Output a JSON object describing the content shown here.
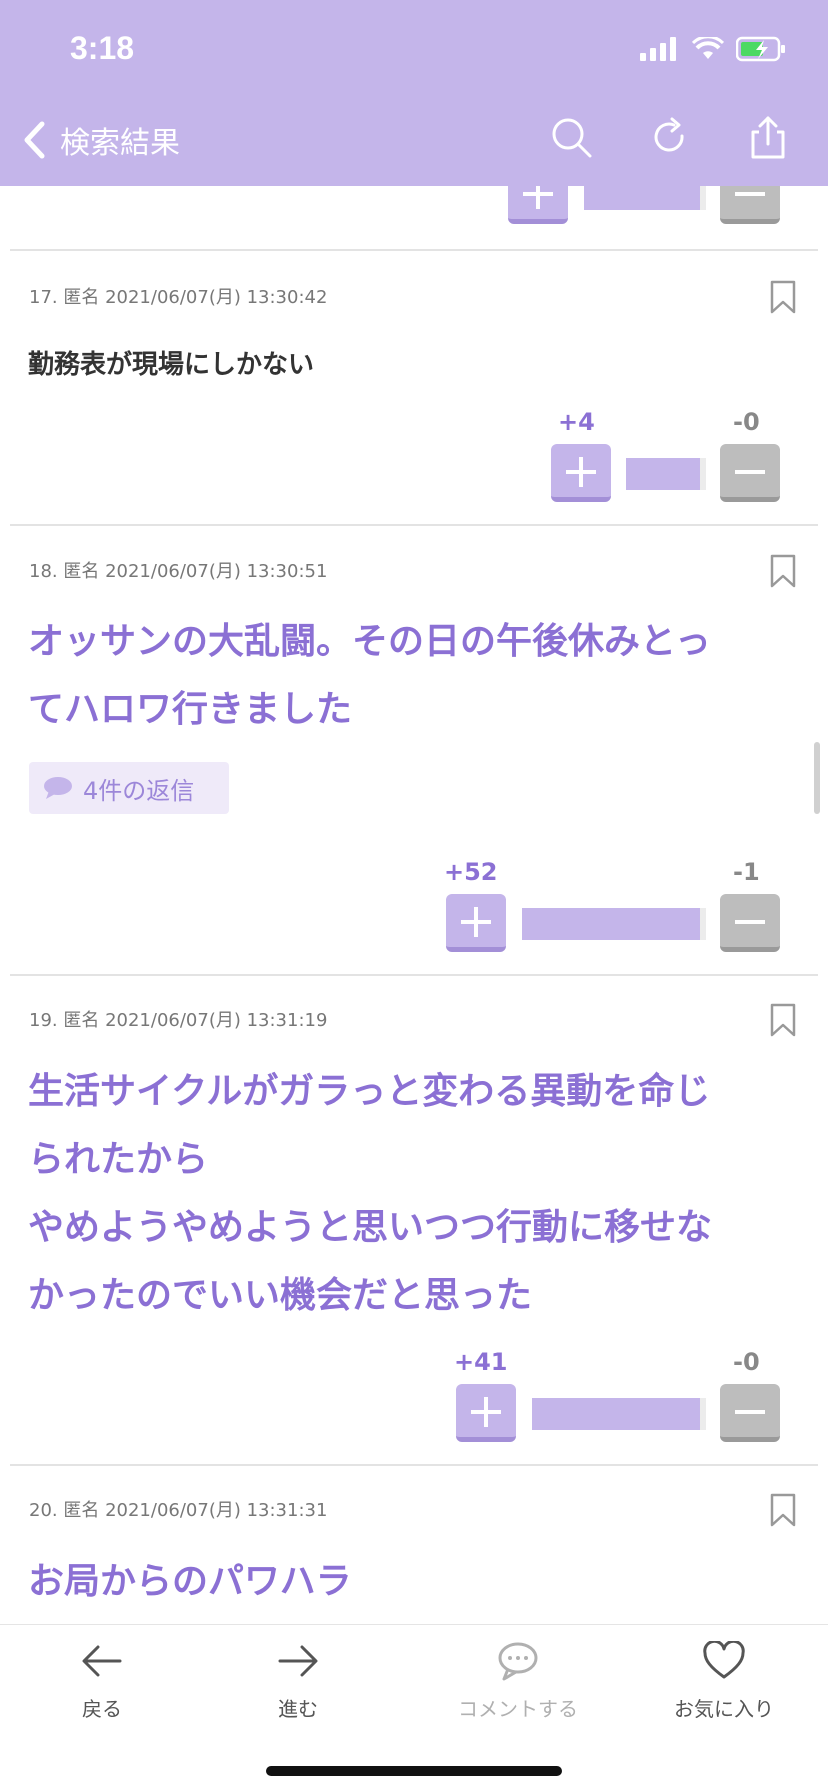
{
  "status": {
    "time": "3:18"
  },
  "nav": {
    "back_label": "検索結果"
  },
  "posts": [
    {
      "meta": "17. 匿名 2021/06/07(月) 13:30:42",
      "body": "勤務表が現場にしかない",
      "plus": "+4",
      "minus": "-0"
    },
    {
      "meta": "18. 匿名 2021/06/07(月) 13:30:51",
      "body_lines": [
        "オッサンの大乱闘。その日の午後休みとっ",
        "てハロワ行きました"
      ],
      "replies": "4件の返信",
      "plus": "+52",
      "minus": "-1"
    },
    {
      "meta": "19. 匿名 2021/06/07(月) 13:31:19",
      "body_lines": [
        "生活サイクルがガラっと変わる異動を命じ",
        "られたから",
        "やめようやめようと思いつつ行動に移せな",
        "かったのでいい機会だと思った"
      ],
      "plus": "+41",
      "minus": "-0"
    },
    {
      "meta": "20. 匿名 2021/06/07(月) 13:31:31",
      "body": "お局からのパワハラ"
    }
  ],
  "tabbar": {
    "back": "戻る",
    "forward": "進む",
    "comment": "コメントする",
    "favorite": "お気に入り"
  },
  "colors": {
    "accent": "#c4b5ea",
    "text_accent": "#8b70d4"
  }
}
